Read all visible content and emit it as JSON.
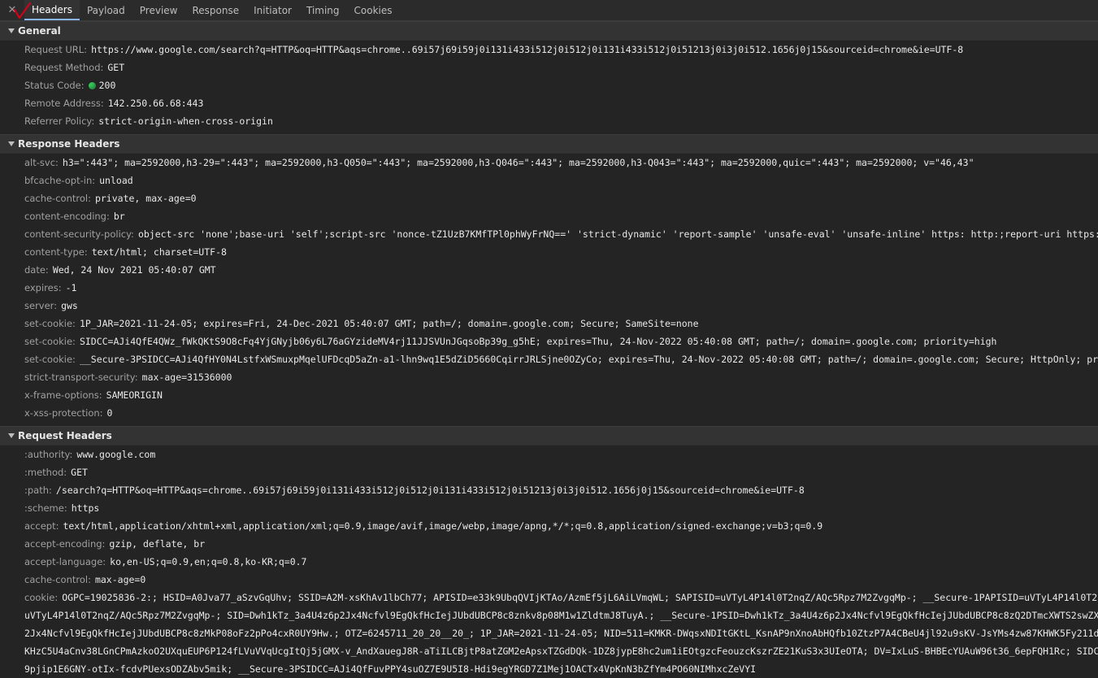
{
  "tabs": [
    {
      "label": "Headers",
      "active": true
    },
    {
      "label": "Payload",
      "active": false
    },
    {
      "label": "Preview",
      "active": false
    },
    {
      "label": "Response",
      "active": false
    },
    {
      "label": "Initiator",
      "active": false
    },
    {
      "label": "Timing",
      "active": false
    },
    {
      "label": "Cookies",
      "active": false
    }
  ],
  "close_glyph": "✕",
  "colors": {
    "status_ok": "#34c759",
    "annotation": "#d0021b"
  },
  "general": {
    "title": "General",
    "rows": [
      {
        "name": "Request URL:",
        "value": "https://www.google.com/search?q=HTTP&oq=HTTP&aqs=chrome..69i57j69i59j0i131i433i512j0i512j0i131i433i512j0i51213j0i3j0i512.1656j0j15&sourceid=chrome&ie=UTF-8"
      },
      {
        "name": "Request Method:",
        "value": "GET"
      },
      {
        "name": "Status Code:",
        "value": "200"
      },
      {
        "name": "Remote Address:",
        "value": "142.250.66.68:443"
      },
      {
        "name": "Referrer Policy:",
        "value": "strict-origin-when-cross-origin"
      }
    ]
  },
  "response": {
    "title": "Response Headers",
    "rows": [
      {
        "name": "alt-svc:",
        "value": "h3=\":443\"; ma=2592000,h3-29=\":443\"; ma=2592000,h3-Q050=\":443\"; ma=2592000,h3-Q046=\":443\"; ma=2592000,h3-Q043=\":443\"; ma=2592000,quic=\":443\"; ma=2592000; v=\"46,43\""
      },
      {
        "name": "bfcache-opt-in:",
        "value": "unload"
      },
      {
        "name": "cache-control:",
        "value": "private, max-age=0"
      },
      {
        "name": "content-encoding:",
        "value": "br"
      },
      {
        "name": "content-security-policy:",
        "value": "object-src 'none';base-uri 'self';script-src 'nonce-tZ1UzB7KMfTPl0phWyFrNQ==' 'strict-dynamic' 'report-sample' 'unsafe-eval' 'unsafe-inline' https: http:;report-uri https://csp.wi"
      },
      {
        "name": "content-type:",
        "value": "text/html; charset=UTF-8"
      },
      {
        "name": "date:",
        "value": "Wed, 24 Nov 2021 05:40:07 GMT"
      },
      {
        "name": "expires:",
        "value": "-1"
      },
      {
        "name": "server:",
        "value": "gws"
      },
      {
        "name": "set-cookie:",
        "value": "1P_JAR=2021-11-24-05; expires=Fri, 24-Dec-2021 05:40:07 GMT; path=/; domain=.google.com; Secure; SameSite=none"
      },
      {
        "name": "set-cookie:",
        "value": "SIDCC=AJi4QfE4QWz_fWkQKtS9O8cFq4YjGNyjb06y6L76aGYzideMV4rj11JJSVUnJGqsoBp39g_g5hE; expires=Thu, 24-Nov-2022 05:40:08 GMT; path=/; domain=.google.com; priority=high"
      },
      {
        "name": "set-cookie:",
        "value": "__Secure-3PSIDCC=AJi4QfHY0N4LstfxWSmuxpMqelUFDcqD5aZn-a1-lhn9wq1E5dZiD5660CqirrJRLSjne0OZyCo; expires=Thu, 24-Nov-2022 05:40:08 GMT; path=/; domain=.google.com; Secure; HttpOnly; priority=hi"
      },
      {
        "name": "strict-transport-security:",
        "value": "max-age=31536000"
      },
      {
        "name": "x-frame-options:",
        "value": "SAMEORIGIN"
      },
      {
        "name": "x-xss-protection:",
        "value": "0"
      }
    ]
  },
  "request": {
    "title": "Request Headers",
    "rows": [
      {
        "name": ":authority:",
        "value": "www.google.com"
      },
      {
        "name": ":method:",
        "value": "GET"
      },
      {
        "name": ":path:",
        "value": "/search?q=HTTP&oq=HTTP&aqs=chrome..69i57j69i59j0i131i433i512j0i512j0i131i433i512j0i51213j0i3j0i512.1656j0j15&sourceid=chrome&ie=UTF-8"
      },
      {
        "name": ":scheme:",
        "value": "https"
      },
      {
        "name": "accept:",
        "value": "text/html,application/xhtml+xml,application/xml;q=0.9,image/avif,image/webp,image/apng,*/*;q=0.8,application/signed-exchange;v=b3;q=0.9"
      },
      {
        "name": "accept-encoding:",
        "value": "gzip, deflate, br"
      },
      {
        "name": "accept-language:",
        "value": "ko,en-US;q=0.9,en;q=0.8,ko-KR;q=0.7"
      },
      {
        "name": "cache-control:",
        "value": "max-age=0"
      },
      {
        "name": "cookie:",
        "value": "OGPC=19025836-2:; HSID=A0Jva77_aSzvGqUhv; SSID=A2M-xsKhAv1lbCh77; APISID=e33k9UbqQVIjKTAo/AzmEf5jL6AiLVmqWL; SAPISID=uVTyL4P14l0T2nqZ/AQc5Rpz7M2ZvgqMp-; __Secure-1PAPISID=uVTyL4P14l0T2nqZ/AQc5R"
      }
    ],
    "cookie_continuation": [
      "uVTyL4P14l0T2nqZ/AQc5Rpz7M2ZvgqMp-; SID=Dwh1kTz_3a4U4z6p2Jx4Ncfvl9EgQkfHcIejJUbdUBCP8c8znkv8p08M1w1ZldtmJ8TuyA.; __Secure-1PSID=Dwh1kTz_3a4U4z6p2Jx4Ncfvl9EgQkfHcIejJUbdUBCP8c8zQ2DTmcXWTS2swZX1ngYfYw.;",
      "2Jx4Ncfvl9EgQkfHcIejJUbdUBCP8c8zMkP08oFz2pPo4cxR0UY9Hw.; OTZ=6245711_20_20__20_; 1P_JAR=2021-11-24-05; NID=511=KMKR-DWqsxNDItGKtL_KsnAP9nXnoAbHQfb10ZtzP7A4CBeU4jl92u9sKV-JsYMs4zw87KHWK5Fy211dr4nypp137",
      "KHzC5U4aCnv38LGnCPmAzkoO2UXquEUP6P124fLVuVVqUcgItQj5jGMX-v_AndXauegJ8R-aTiILCBjtP8atZGM2eApsxTZGdDQk-1DZ8jypE8hc2um1iEOtgzcFeouzcKszrZE21KuS3x3UIeOTA; DV=IxLuS-BHBEcYUAuW96t36_6epFQH1Rc; SIDCC=AJi4QfGE",
      "9pjip1E6GNY-otIx-fcdvPUexsODZAbv5mik; __Secure-3PSIDCC=AJi4QfFuvPPY4suOZ7E9U5I8-Hdi9egYRGD7Z1Mej1OACTx4VpKnN3bZfYm4PO60NIMhxcZeVYI"
    ]
  }
}
